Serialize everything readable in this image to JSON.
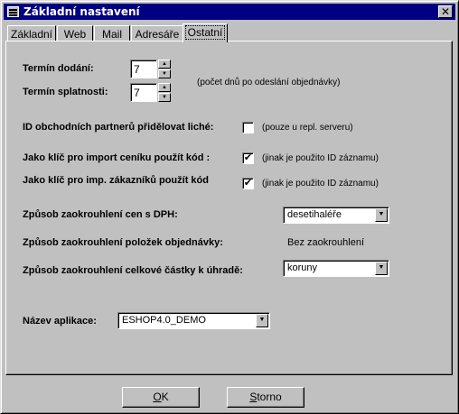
{
  "window": {
    "title": "Základní nastavení",
    "close_symbol": "✕"
  },
  "tabs": [
    {
      "label": "Základní",
      "active": false
    },
    {
      "label": "Web",
      "active": false
    },
    {
      "label": "Mail",
      "active": false
    },
    {
      "label": "Adresáře",
      "active": false
    },
    {
      "label": "Ostatní",
      "active": true
    }
  ],
  "form": {
    "termin_dodani": {
      "label": "Termín dodání:",
      "value": "7"
    },
    "termin_splatnosti": {
      "label": "Termín splatnosti:",
      "value": "7"
    },
    "days_note": "(počet dnů po odeslání objednávky)",
    "id_partneru": {
      "label": "ID obchodních partnerů přidělovat liché:",
      "checked": false,
      "note": "(pouze u repl. serveru)"
    },
    "cenik_kod": {
      "label": "Jako klíč pro import ceníku použít kód :",
      "checked": true,
      "note": "(jinak je použito ID záznamu)"
    },
    "zakaznici_kod": {
      "label": "Jako klíč pro imp. zákazníků použít kód",
      "checked": true,
      "note": "(jinak je použito ID záznamu)"
    },
    "zaokrouhleni_cen": {
      "label": "Způsob zaokrouhlení cen  s DPH:",
      "value": "desetihaléře"
    },
    "zaokrouhleni_polozek": {
      "label": "Způsob zaokrouhlení položek objednávky:",
      "value": "Bez zaokrouhlení"
    },
    "zaokrouhleni_castky": {
      "label": "Způsob zaokrouhlení celkové částky k úhradě:",
      "value": "koruny"
    },
    "nazev_aplikace": {
      "label": "Název aplikace:",
      "value": "ESHOP4.0_DEMO"
    }
  },
  "buttons": {
    "ok_u": "O",
    "ok": "K",
    "storno_u": "S",
    "storno": "torno"
  },
  "check_mark": "✔"
}
